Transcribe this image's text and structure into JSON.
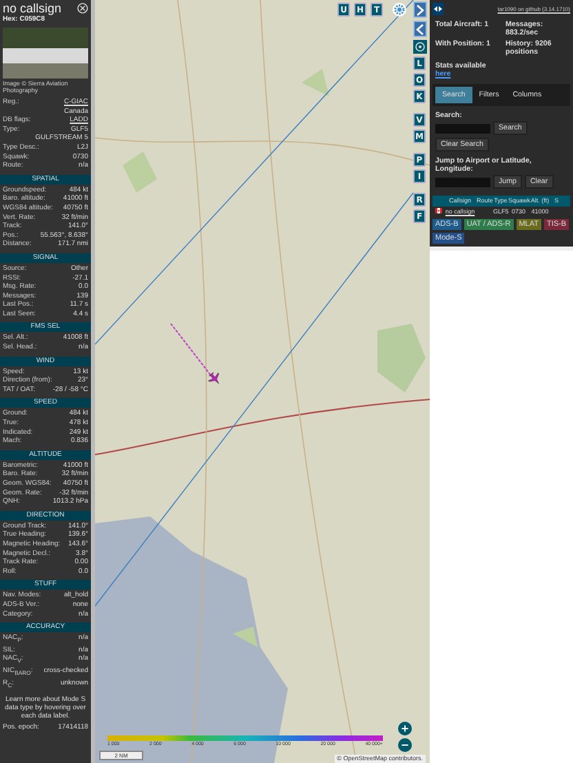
{
  "aircraft": {
    "title": "no callsign",
    "hex": "Hex: C059C8"
  },
  "photo": {
    "caption": "Image © Sierra Aviation Photography"
  },
  "details": [
    {
      "label": "Reg.:",
      "value": "C-GIAC",
      "kind": "link"
    },
    {
      "value": "Canada",
      "kind": "text"
    },
    {
      "label": "DB flags:",
      "value": "LADD",
      "kind": "link"
    },
    {
      "label": "Type:",
      "value": "GLF5",
      "kind": "text"
    },
    {
      "value": "GULFSTREAM 5",
      "kind": "text"
    },
    {
      "label": "Type Desc.:",
      "value": "L2J",
      "kind": "text"
    },
    {
      "label": "Squawk:",
      "value": "0730",
      "kind": "text"
    },
    {
      "label": "Route:",
      "value": "n/a",
      "kind": "text"
    }
  ],
  "sections": [
    {
      "title": "SPATIAL",
      "rows": [
        {
          "label": "Groundspeed:",
          "value": "484 kt"
        },
        {
          "label": "Baro. altitude:",
          "value": "41000 ft"
        },
        {
          "label": "WGS84 altitude:",
          "value": "40750 ft"
        },
        {
          "label": "Vert. Rate:",
          "value": "32 ft/min"
        },
        {
          "label": "Track:",
          "value": "141.0°"
        },
        {
          "label": "Pos.:",
          "value": "55.563°, 8.638°"
        },
        {
          "label": "Distance:",
          "value": "171.7 nmi"
        }
      ]
    },
    {
      "title": "SIGNAL",
      "rows": [
        {
          "label": "Source:",
          "value": "Other"
        },
        {
          "label": "RSSI:",
          "value": "-27.1"
        },
        {
          "label": "Msg. Rate:",
          "value": "0.0"
        },
        {
          "label": "Messages:",
          "value": "139"
        },
        {
          "label": "Last Pos.:",
          "value": "11.7 s"
        },
        {
          "label": "Last Seen:",
          "value": "4.4 s"
        }
      ]
    },
    {
      "title": "FMS SEL",
      "rows": [
        {
          "label": "Sel. Alt.:",
          "value": "41008 ft"
        },
        {
          "label": "Sel. Head.:",
          "value": "n/a"
        }
      ]
    },
    {
      "title": "WIND",
      "rows": [
        {
          "label": "Speed:",
          "value": "13 kt"
        },
        {
          "label": "Direction (from):",
          "value": "23°"
        },
        {
          "label": "TAT / OAT:",
          "value": "-28 / -58 °C"
        }
      ]
    },
    {
      "title": "SPEED",
      "rows": [
        {
          "label": "Ground:",
          "value": "484 kt"
        },
        {
          "label": "True:",
          "value": "478 kt"
        },
        {
          "label": "Indicated:",
          "value": "249 kt"
        },
        {
          "label": "Mach:",
          "value": "0.836"
        }
      ]
    },
    {
      "title": "ALTITUDE",
      "rows": [
        {
          "label": "Barometric:",
          "value": "41000 ft"
        },
        {
          "label": "Baro. Rate:",
          "value": "32 ft/min"
        },
        {
          "label": "Geom. WGS84:",
          "value": "40750 ft"
        },
        {
          "label": "Geom. Rate:",
          "value": "-32 ft/min"
        },
        {
          "label": "QNH:",
          "value": "1013.2 hPa"
        }
      ]
    },
    {
      "title": "DIRECTION",
      "rows": [
        {
          "label": "Ground Track:",
          "value": "141.0°"
        },
        {
          "label": "True Heading:",
          "value": "139.6°"
        },
        {
          "label": "Magnetic Heading:",
          "value": "143.6°"
        },
        {
          "label": "Magnetic Decl.:",
          "value": "3.8°"
        },
        {
          "label": "Track Rate:",
          "value": "0.00"
        },
        {
          "label": "Roll:",
          "value": "0.0"
        }
      ]
    },
    {
      "title": "STUFF",
      "rows": [
        {
          "label": "Nav. Modes:",
          "value": "alt_hold"
        },
        {
          "label": "ADS-B Ver.:",
          "value": "none"
        },
        {
          "label": "Category:",
          "value": "n/a"
        }
      ]
    },
    {
      "title": "ACCURACY",
      "rows": [
        {
          "label": "NAC$_{P}$:",
          "value": "n/a"
        },
        {
          "label": "SIL:",
          "value": "n/a"
        },
        {
          "label": "NAC$_{V}$:",
          "value": "n/a"
        },
        {
          "label": "NIC$_{BARO}$:",
          "value": "cross-checked"
        },
        {
          "label": "R$_{C}$:",
          "value": "unknown"
        }
      ]
    }
  ],
  "footer": {
    "note": "Learn more about Mode S data type by hovering over each data label.",
    "epoch_label": "Pos. epoch:",
    "epoch_value": "17414118"
  },
  "map": {
    "top_buttons": [
      "U",
      "H",
      "T"
    ],
    "side_groups": [
      [
        "L",
        "O",
        "K"
      ],
      [
        "V",
        "M"
      ],
      [
        "P",
        "I"
      ],
      [
        "R",
        "F"
      ]
    ],
    "zoom_in": "+",
    "zoom_out": "−",
    "legend_labels": [
      "1 000",
      "2 000",
      "4 000",
      "6 000",
      "10 000",
      "20 000",
      "40 000+"
    ],
    "scale": "2 NM",
    "attribution": "© OpenStreetMap contributors."
  },
  "panel": {
    "version_link": "tar1090 on github (3.14.1710)",
    "stats": [
      {
        "label": "Total Aircraft:",
        "value": "1"
      },
      {
        "label": "Messages:",
        "value": "883.2/sec"
      },
      {
        "label": "With Position:",
        "value": "1"
      },
      {
        "label": "History:",
        "value": "9206 positions"
      }
    ],
    "stats_note": "Stats available",
    "stats_link": "here",
    "tabs": [
      {
        "label": "Search",
        "selected": true
      },
      {
        "label": "Filters",
        "selected": false
      },
      {
        "label": "Columns",
        "selected": false
      }
    ],
    "search_label": "Search:",
    "search_button": "Search",
    "clear_search": "Clear Search",
    "jump_label": "Jump to Airport or Latitude, Longitude:",
    "jump_button": "Jump",
    "clear_button": "Clear",
    "columns": [
      "Callsign",
      "Route",
      "Type",
      "Squawk",
      "Alt. (ft)",
      "S"
    ],
    "rows": [
      {
        "callsign": "no callsign",
        "route": "",
        "type": "GLF5",
        "squawk": "0730",
        "alt": "41000",
        "selected": false
      }
    ],
    "legend": [
      {
        "label": "ADS-B",
        "color": "#1e5c8c"
      },
      {
        "label": "UAT / ADS-R",
        "color": "#2e7d4a"
      },
      {
        "label": "MLAT",
        "color": "#6b6b1f"
      },
      {
        "label": "TIS-B",
        "color": "#7a2a3a"
      },
      {
        "label": "Mode-S",
        "color": "#24508a"
      }
    ]
  }
}
